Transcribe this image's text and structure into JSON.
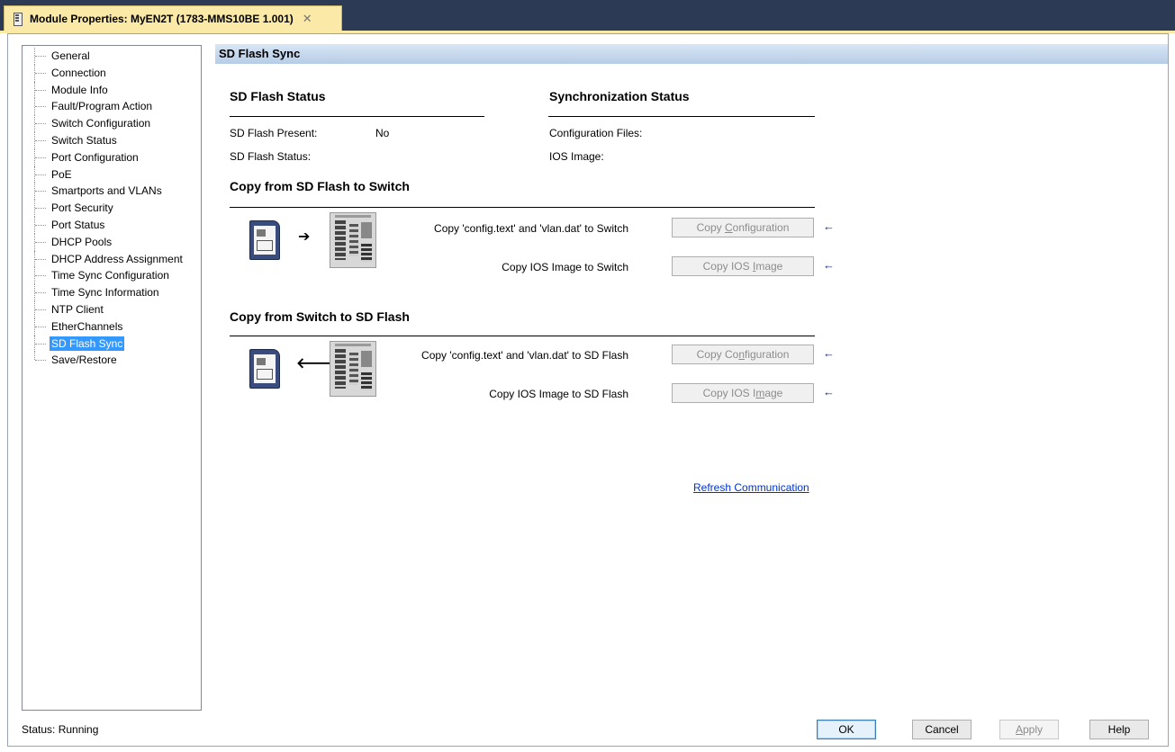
{
  "tab": {
    "title": "Module Properties: MyEN2T (1783-MMS10BE 1.001)",
    "close_glyph": "✕"
  },
  "nav": {
    "items": [
      {
        "label": "General"
      },
      {
        "label": "Connection"
      },
      {
        "label": "Module Info"
      },
      {
        "label": "Fault/Program Action"
      },
      {
        "label": "Switch Configuration"
      },
      {
        "label": "Switch Status"
      },
      {
        "label": "Port Configuration"
      },
      {
        "label": "PoE"
      },
      {
        "label": "Smartports and VLANs"
      },
      {
        "label": "Port Security"
      },
      {
        "label": "Port Status"
      },
      {
        "label": "DHCP Pools"
      },
      {
        "label": "DHCP Address Assignment"
      },
      {
        "label": "Time Sync Configuration"
      },
      {
        "label": "Time Sync Information"
      },
      {
        "label": "NTP Client"
      },
      {
        "label": "EtherChannels"
      },
      {
        "label": "SD Flash Sync"
      },
      {
        "label": "Save/Restore"
      }
    ],
    "selected": "SD Flash Sync"
  },
  "panel": {
    "header": "SD Flash Sync",
    "sd_status": {
      "title": "SD Flash Status",
      "present_label": "SD Flash Present:",
      "present_value": "No",
      "status_label": "SD Flash Status:",
      "status_value": ""
    },
    "sync_status": {
      "title": "Synchronization Status",
      "config_label": "Configuration Files:",
      "config_value": "",
      "ios_label": "IOS Image:",
      "ios_value": ""
    },
    "to_switch": {
      "title": "Copy from SD Flash to Switch",
      "config_desc": "Copy 'config.text' and 'vlan.dat' to Switch",
      "config_btn_pre": "Copy ",
      "config_btn_u": "C",
      "config_btn_post": "onfiguration",
      "ios_desc": "Copy IOS Image to Switch",
      "ios_btn_pre": "Copy IOS ",
      "ios_btn_u": "I",
      "ios_btn_post": "mage",
      "flow_arrow": "➔"
    },
    "to_sd": {
      "title": "Copy from Switch to SD Flash",
      "config_desc": "Copy 'config.text' and 'vlan.dat' to SD Flash",
      "config_btn_pre": "Copy Co",
      "config_btn_u": "n",
      "config_btn_post": "figuration",
      "ios_desc": "Copy IOS Image to SD Flash",
      "ios_btn_pre": "Copy IOS I",
      "ios_btn_u": "m",
      "ios_btn_post": "age",
      "flow_arrow": "🡐"
    },
    "pointer_glyph": "←",
    "refresh_link": "Refresh Communication"
  },
  "footer": {
    "status_text": "Status:  Running",
    "ok": "OK",
    "cancel": "Cancel",
    "apply_pre": "",
    "apply_u": "A",
    "apply_post": "pply",
    "help": "Help"
  },
  "colors": {
    "titlebar": "#2c3a55",
    "tab_active": "#fbe9a8",
    "header_gradient_top": "#d9e6f5",
    "header_gradient_bottom": "#b6cce6",
    "selection": "#3399ff",
    "link": "#0033cc"
  }
}
